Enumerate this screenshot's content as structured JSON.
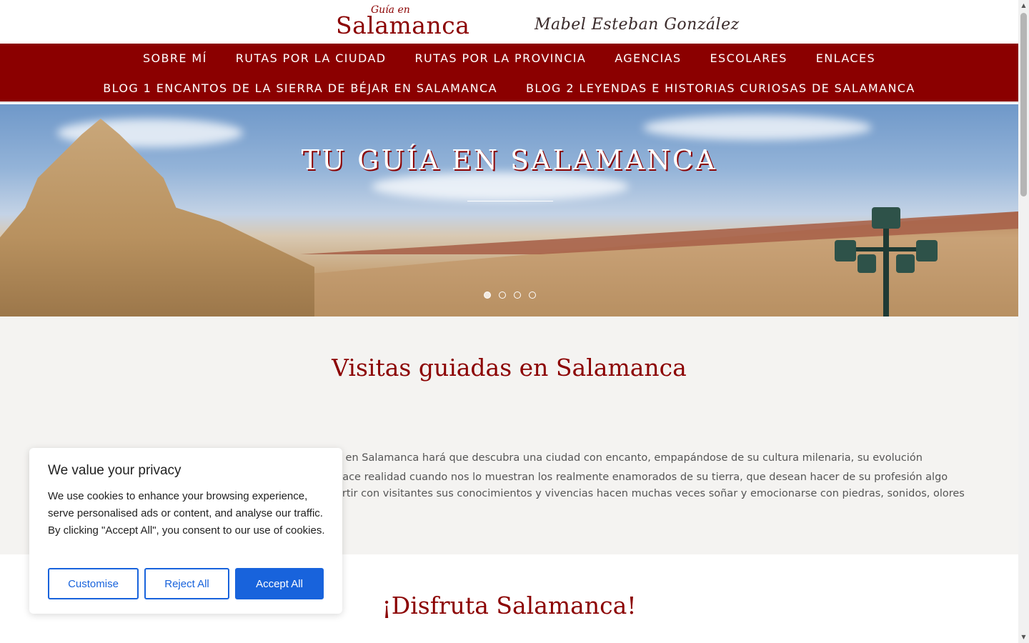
{
  "header": {
    "logo_small": "Guía en",
    "logo_main": "Salamanca",
    "signature": "Mabel Esteban González"
  },
  "nav": {
    "row1": [
      "SOBRE MÍ",
      "RUTAS POR LA CIUDAD",
      "RUTAS POR LA PROVINCIA",
      "AGENCIAS",
      "ESCOLARES",
      "ENLACES"
    ],
    "row2": [
      "BLOG 1 ENCANTOS DE LA SIERRA DE BÉJAR EN SALAMANCA",
      "BLOG 2 LEYENDAS E HISTORIAS CURIOSAS DE SALAMANCA"
    ]
  },
  "hero": {
    "title": "TU GUÍA EN SALAMANCA",
    "slides_total": 4,
    "active_slide": 1
  },
  "section1": {
    "title": "Visitas guiadas en Salamanca",
    "line1_link": "e",
    "line1": " en Salamanca hará que descubra una ciudad con encanto, empapándose de su cultura milenaria, su evolución",
    "line2": "hace realidad cuando nos lo muestran los realmente enamorados de su tierra, que desean hacer de su profesión algo",
    "line3": "artir con visitantes sus conocimientos y vivencias hacen muchas veces soñar y emocionarse con piedras, sonidos, olores"
  },
  "section2": {
    "title": "¡Disfruta Salamanca!"
  },
  "cookie": {
    "title": "We value your privacy",
    "text": "We use cookies to enhance your browsing experience, serve personalised ads or content, and analyse our traffic. By clicking \"Accept All\", you consent to our use of cookies.",
    "customise": "Customise",
    "reject": "Reject All",
    "accept": "Accept All",
    "accent": "#1863dc"
  },
  "colors": {
    "brand": "#8b0000",
    "section_bg": "#f4f3f1"
  }
}
